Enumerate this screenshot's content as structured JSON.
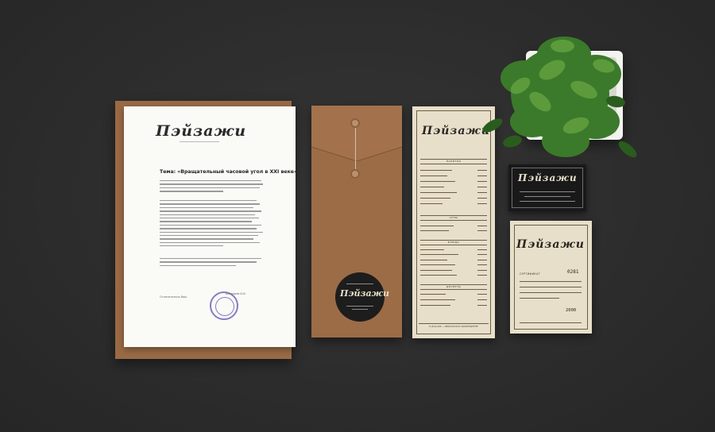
{
  "scene": {
    "background_color": "#2e2e2e",
    "description_items": [
      "letterhead",
      "envelope",
      "menu",
      "business-card",
      "certificate",
      "potted-plant"
    ]
  },
  "letterhead": {
    "logo": "Пэйзажи",
    "heading": "Тема: «Вращательный часовой угол в XXI веке»",
    "signature_label": "Отличительно Ваш",
    "signature_name": "Бондарев И.И."
  },
  "envelope": {
    "sticker_logo": "Пэйзажи"
  },
  "menu": {
    "logo": "Пэйзажи",
    "sections": [
      "НАПИТКИ",
      "СУПЫ",
      "БЛЮДА",
      "ДЕСЕРТЫ"
    ],
    "footer": "8 (910) 000 — СВЯЗАТЬСЯ НА БАНКЕТЦЕНТРЕ"
  },
  "business_card": {
    "logo": "Пэйзажи"
  },
  "certificate": {
    "logo": "Пэйзажи",
    "title": "СЕРТИФИКАТ",
    "number": "0281",
    "amount": "2000"
  },
  "colors": {
    "kraft": "#9c6c47",
    "cream": "#e8dfca",
    "card_black": "#191919",
    "plant_green": "#3f7a2c"
  }
}
